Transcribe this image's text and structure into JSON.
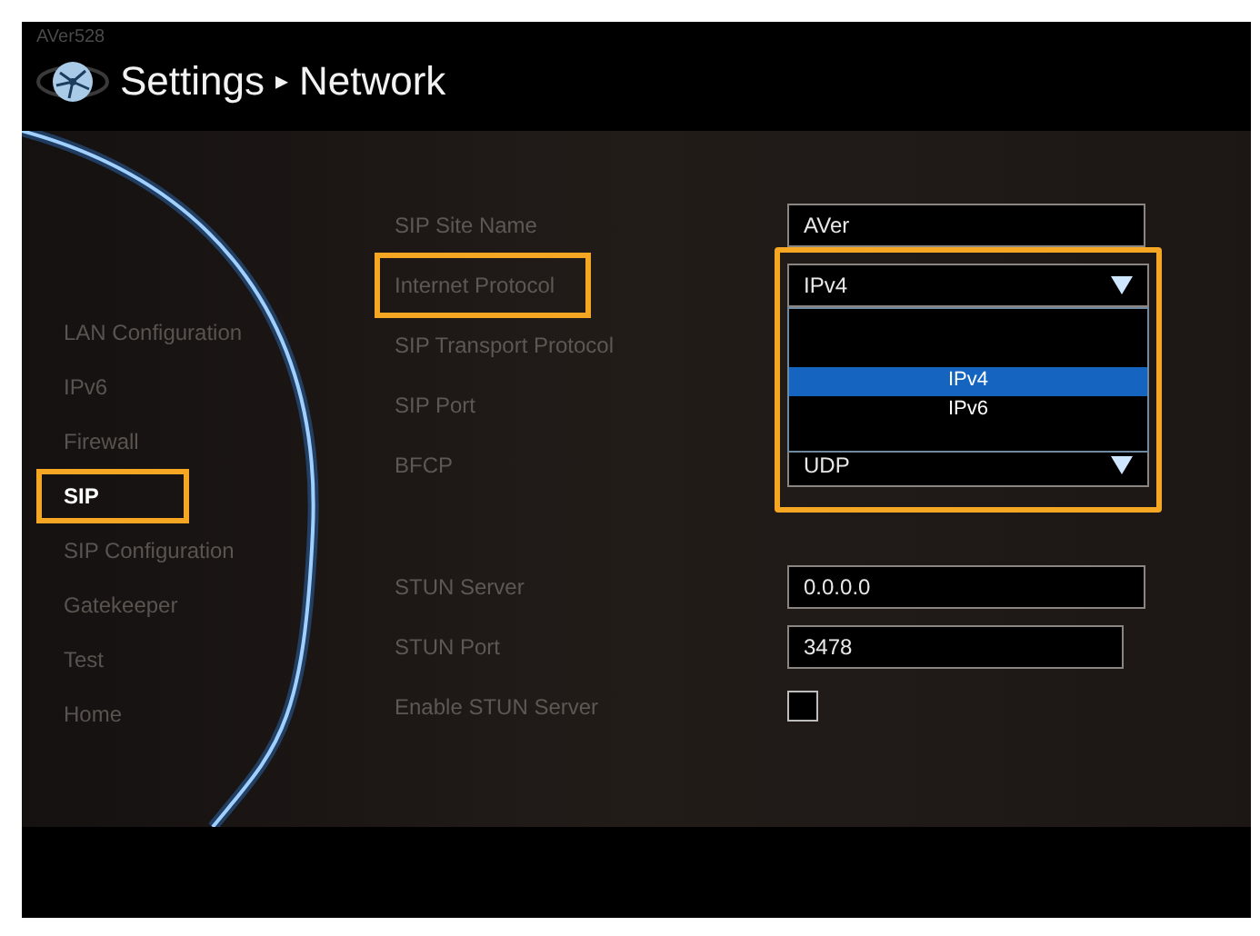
{
  "header": {
    "device_name": "AVer528",
    "title": "Settings",
    "separator": "▸",
    "section": "Network"
  },
  "sidebar": {
    "items": [
      {
        "label": "LAN Configuration",
        "selected": false
      },
      {
        "label": "IPv6",
        "selected": false
      },
      {
        "label": "Firewall",
        "selected": false
      },
      {
        "label": "SIP",
        "selected": true
      },
      {
        "label": "SIP Configuration",
        "selected": false
      },
      {
        "label": "Gatekeeper",
        "selected": false
      },
      {
        "label": "Test",
        "selected": false
      },
      {
        "label": "Home",
        "selected": false
      }
    ]
  },
  "form": {
    "rows": [
      {
        "label": "SIP Site Name",
        "kind": "text",
        "value": "AVer",
        "highlighted": false
      },
      {
        "label": "Internet Protocol",
        "kind": "select",
        "value": "IPv4",
        "highlighted": true,
        "expanded": true,
        "options": [
          {
            "label": "IPv4",
            "selected": true
          },
          {
            "label": "IPv6",
            "selected": false
          }
        ]
      },
      {
        "label": "SIP Transport Protocol",
        "kind": "hidden",
        "highlighted": false
      },
      {
        "label": "SIP Port",
        "kind": "hidden",
        "highlighted": false
      },
      {
        "label": "BFCP",
        "kind": "select",
        "value": "UDP",
        "highlighted": false,
        "expanded": false
      },
      {
        "kind": "gap"
      },
      {
        "label": "STUN Server",
        "kind": "text",
        "value": "0.0.0.0",
        "highlighted": false
      },
      {
        "label": "STUN Port",
        "kind": "short_text",
        "value": "3478",
        "highlighted": false
      },
      {
        "label": "Enable STUN Server",
        "kind": "checkbox",
        "checked": false,
        "highlighted": false
      }
    ]
  }
}
